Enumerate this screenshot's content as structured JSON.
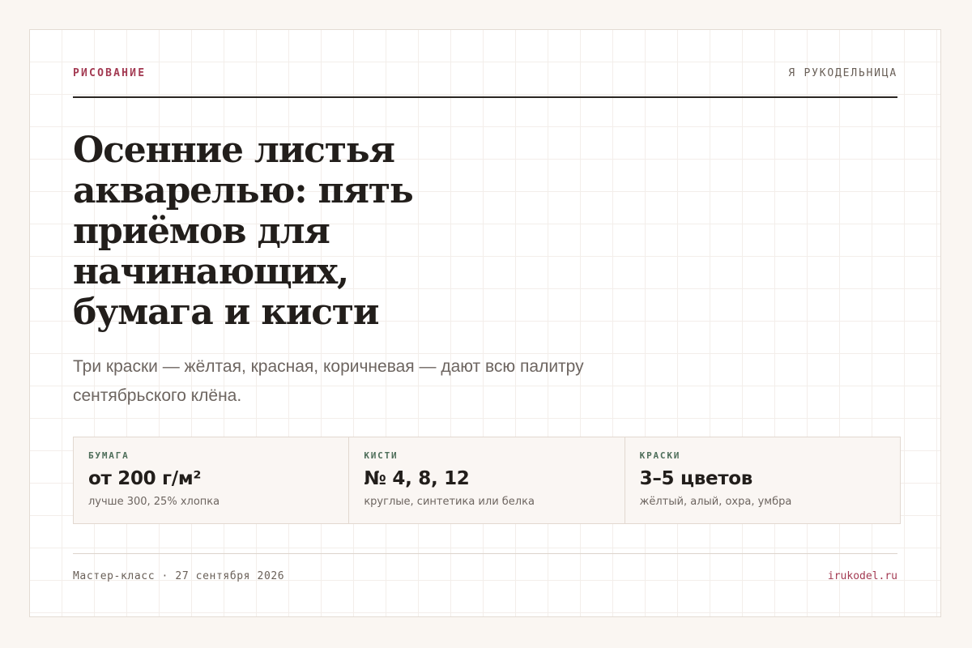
{
  "header": {
    "kicker": "РИСОВАНИЕ",
    "brand": "Я РУКОДЕЛЬНИЦА"
  },
  "article": {
    "title": "Осенние листья акварелью: пять приёмов для начинающих, бумага и кисти",
    "lede": "Три краски — жёлтая, красная, коричневая — дают всю палитру сентябрьского клёна."
  },
  "specs": [
    {
      "label": "БУМАГА",
      "value": "от 200 г/м²",
      "note": "лучше 300, 25% хлопка"
    },
    {
      "label": "КИСТИ",
      "value": "№ 4, 8, 12",
      "note": "круглые, синтетика или белка"
    },
    {
      "label": "КРАСКИ",
      "value": "3–5 цветов",
      "note": "жёлтый, алый, охра, умбра"
    }
  ],
  "footer": {
    "event": "Мастер-класс · 27 сентября 2026",
    "site": "irukodel.ru"
  },
  "colors": {
    "accent": "#a33a52",
    "label_green": "#4e6e5a",
    "text": "#221e1b",
    "muted": "#6d6560",
    "page_bg": "#faf6f2"
  }
}
